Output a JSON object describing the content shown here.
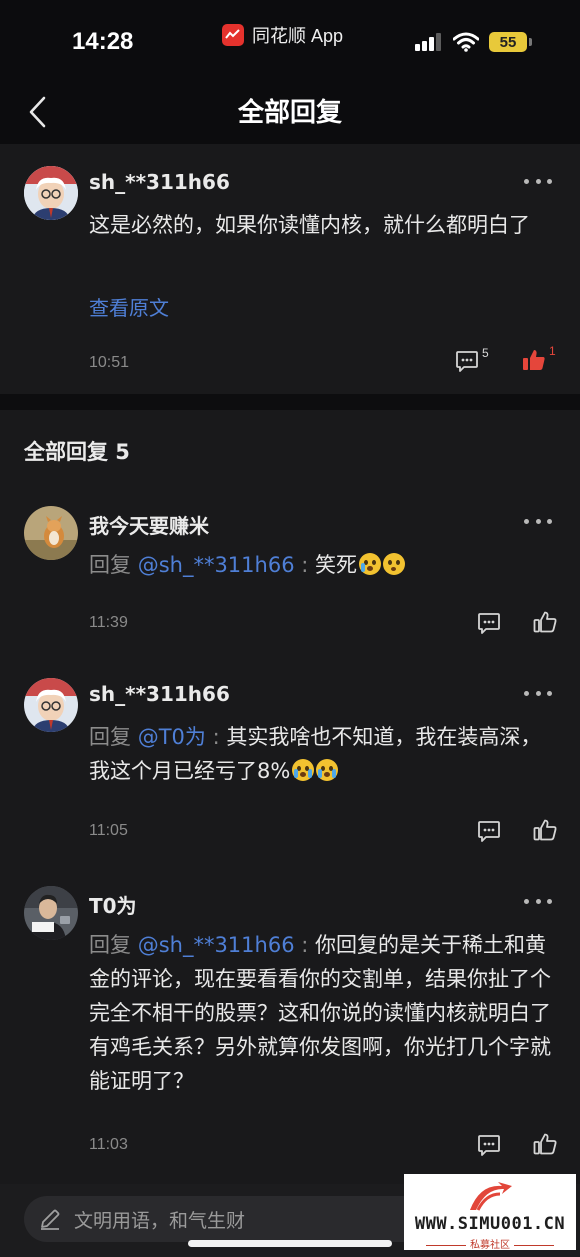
{
  "status_bar": {
    "time": "14:28",
    "app_name": "同花顺 App",
    "battery": "55"
  },
  "header": {
    "title": "全部回复"
  },
  "main_comment": {
    "username": "sh_**311h66",
    "text": "这是必然的，如果你读懂内核，就什么都明白了",
    "view_original": "查看原文",
    "time": "10:51",
    "reply_count": "5",
    "like_count": "1"
  },
  "replies_header": "全部回复 5",
  "replies": [
    {
      "username": "我今天要赚米",
      "prefix": "回复 ",
      "mention": "@sh_**311h66",
      "separator": " : ",
      "text": "笑死",
      "time": "11:39"
    },
    {
      "username": "sh_**311h66",
      "prefix": "回复 ",
      "mention": "@T0为",
      "separator": " : ",
      "text": "其实我啥也不知道，我在装高深，我这个月已经亏了8%",
      "time": "11:05"
    },
    {
      "username": "T0为",
      "prefix": "回复 ",
      "mention": "@sh_**311h66",
      "separator": " : ",
      "text": "你回复的是关于稀土和黄金的评论，现在要看看你的交割单，结果你扯了个完全不相干的股票？这和你说的读懂内核就明白了有鸡毛关系？另外就算你发图啊，你光打几个字就能证明了？",
      "time": "11:03"
    }
  ],
  "input": {
    "placeholder": "文明用语，和气生财"
  },
  "watermark": {
    "site": "WWW.SIMU001.CN",
    "sub": "私募社区"
  },
  "colors": {
    "accent_blue": "#4f7fd6",
    "like_red": "#e5463b",
    "card_bg": "#19191b"
  }
}
